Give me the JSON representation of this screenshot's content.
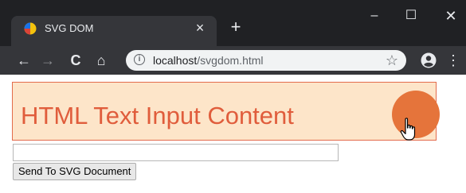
{
  "browser": {
    "tab": {
      "title": "SVG DOM",
      "close_glyph": "×"
    },
    "new_tab_glyph": "+",
    "window_controls": {
      "minimize": "–",
      "maximize": "☐",
      "close": "✕"
    },
    "toolbar": {
      "back_glyph": "←",
      "forward_glyph": "→",
      "reload_glyph": "C",
      "home_glyph": "⌂",
      "url_host": "localhost",
      "url_path": "/svgdom.html",
      "bookmark_glyph": "☆",
      "menu_glyph": "⋮"
    }
  },
  "page": {
    "svg_text": "HTML Text Input Content",
    "input": {
      "value": "",
      "placeholder": ""
    },
    "send_button_label": "Send To SVG Document"
  },
  "colors": {
    "svg_fill": "#fde5c9",
    "svg_text": "#e05d3c",
    "circle": "#e5743b"
  }
}
